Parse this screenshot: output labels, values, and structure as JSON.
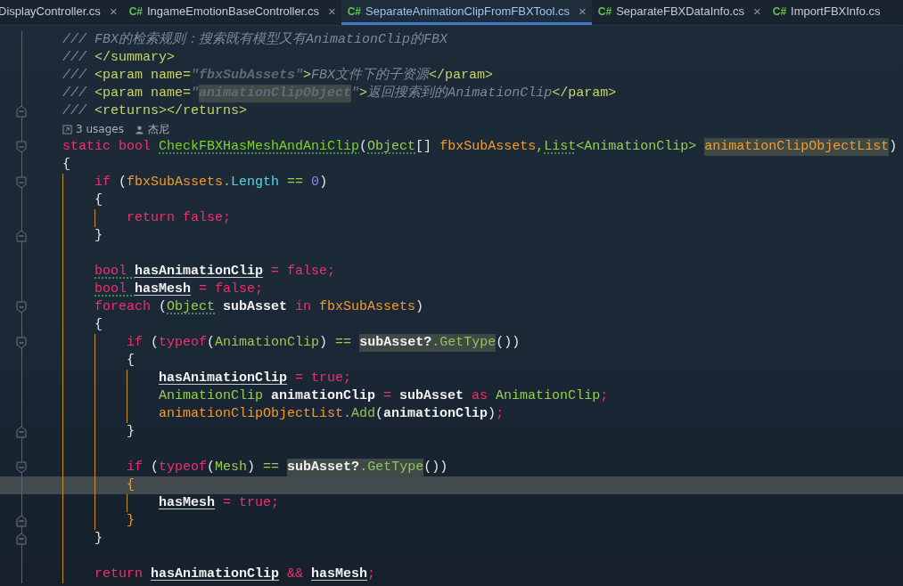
{
  "tabs": [
    {
      "label": "DisplayController.cs",
      "close": "×",
      "selected": false
    },
    {
      "icon_text": "C#",
      "label": "IngameEmotionBaseController.cs",
      "close": "×",
      "selected": false
    },
    {
      "icon_text": "C#",
      "label": "SeparateAnimationClipFromFBXTool.cs",
      "close": "×",
      "selected": true
    },
    {
      "icon_text": "C#",
      "label": "SeparateFBXDataInfo.cs",
      "close": "×",
      "selected": false
    },
    {
      "icon_text": "C#",
      "label": "ImportFBXInfo.cs",
      "selected": false
    }
  ],
  "lines": [
    {
      "kind": "code",
      "current": false,
      "tokens": [
        {
          "t": "/// FBX的检索规则：搜索既有模型又有AnimationClip的FBX",
          "kind": "comment"
        }
      ]
    },
    {
      "kind": "code",
      "current": false,
      "tokens": [
        {
          "t": "/// ",
          "kind": "comment"
        },
        {
          "t": "</summary>",
          "kind": "tag"
        }
      ]
    },
    {
      "kind": "code",
      "current": false,
      "tokens": [
        {
          "t": "/// ",
          "kind": "comment"
        },
        {
          "t": "<param name=",
          "kind": "tag"
        },
        {
          "t": "\"fbxSubAssets\"",
          "kind": "str"
        },
        {
          "t": ">",
          "kind": "tag"
        },
        {
          "t": "FBX文件下的子资源",
          "kind": "comment"
        },
        {
          "t": "</param>",
          "kind": "tag"
        }
      ]
    },
    {
      "kind": "code",
      "current": false,
      "tokens": [
        {
          "t": "/// ",
          "kind": "comment"
        },
        {
          "t": "<param name=",
          "kind": "tag"
        },
        {
          "t": "\"",
          "kind": "str"
        },
        {
          "t": "animationClipObject",
          "kind": "str",
          "mark": true
        },
        {
          "t": "\"",
          "kind": "str"
        },
        {
          "t": ">",
          "kind": "tag"
        },
        {
          "t": "返回搜索到的AnimationClip",
          "kind": "comment"
        },
        {
          "t": "</param>",
          "kind": "tag"
        }
      ]
    },
    {
      "kind": "code",
      "current": false,
      "fold_end": true,
      "tokens": [
        {
          "t": "/// ",
          "kind": "comment"
        },
        {
          "t": "<returns></returns>",
          "kind": "tag"
        }
      ]
    },
    {
      "kind": "lens",
      "usages": "3 usages",
      "author": "杰尼"
    },
    {
      "kind": "code",
      "current": false,
      "fold_start": true,
      "tokens": [
        {
          "t": "static bool ",
          "kind": "kw"
        },
        {
          "t": "CheckFBXHasMeshAndAniClip",
          "kind": "fn",
          "hint": true
        },
        {
          "t": "(",
          "kind": "punct"
        },
        {
          "t": "Object",
          "kind": "type",
          "hint": true
        },
        {
          "t": "[] ",
          "kind": "punct"
        },
        {
          "t": "fbxSubAssets",
          "kind": "param"
        },
        {
          "t": ",",
          "kind": "op"
        },
        {
          "t": "List",
          "kind": "type",
          "hint": true
        },
        {
          "t": "<",
          "kind": "op"
        },
        {
          "t": "AnimationClip",
          "kind": "type"
        },
        {
          "t": "> ",
          "kind": "op"
        },
        {
          "t": "animationClipObjectList",
          "kind": "param",
          "mark": true
        },
        {
          "t": ")",
          "kind": "punct"
        }
      ]
    },
    {
      "kind": "code",
      "current": false,
      "tokens": [
        {
          "t": "{",
          "kind": "punct"
        }
      ]
    },
    {
      "kind": "block",
      "children": [
        {
          "kind": "code",
          "current": false,
          "fold_start": true,
          "tokens": [
            {
              "t": "if ",
              "kind": "kw"
            },
            {
              "t": "(",
              "kind": "punct"
            },
            {
              "t": "fbxSubAssets",
              "kind": "param"
            },
            {
              "t": ".",
              "kind": "op"
            },
            {
              "t": "Length",
              "kind": "prop"
            },
            {
              "t": " == ",
              "kind": "op"
            },
            {
              "t": "0",
              "kind": "num"
            },
            {
              "t": ")",
              "kind": "punct"
            }
          ]
        },
        {
          "kind": "code",
          "current": false,
          "tokens": [
            {
              "t": "{",
              "kind": "punct"
            }
          ]
        },
        {
          "kind": "block",
          "children": [
            {
              "kind": "code",
              "current": false,
              "tokens": [
                {
                  "t": "return false;",
                  "kind": "kw"
                }
              ]
            }
          ]
        },
        {
          "kind": "code",
          "current": false,
          "fold_end": true,
          "tokens": [
            {
              "t": "}",
              "kind": "punct"
            }
          ]
        },
        {
          "kind": "blank"
        },
        {
          "kind": "code",
          "current": false,
          "tokens": [
            {
              "t": "bool ",
              "kind": "kw",
              "hint": true
            },
            {
              "t": "hasAnimationClip",
              "kind": "local"
            },
            {
              "t": " = false;",
              "kind": "kw"
            }
          ]
        },
        {
          "kind": "code",
          "current": false,
          "tokens": [
            {
              "t": "bool ",
              "kind": "kw",
              "hint": true
            },
            {
              "t": "hasMesh",
              "kind": "local"
            },
            {
              "t": " = false;",
              "kind": "kw"
            }
          ]
        },
        {
          "kind": "code",
          "current": false,
          "fold_start": true,
          "tokens": [
            {
              "t": "foreach ",
              "kind": "kw"
            },
            {
              "t": "(",
              "kind": "punct"
            },
            {
              "t": "Object",
              "kind": "type",
              "hint": true
            },
            {
              "t": " subAsset ",
              "kind": "var"
            },
            {
              "t": "in ",
              "kind": "kw"
            },
            {
              "t": "fbxSubAssets",
              "kind": "param"
            },
            {
              "t": ")",
              "kind": "punct"
            }
          ]
        },
        {
          "kind": "code",
          "current": false,
          "tokens": [
            {
              "t": "{",
              "kind": "punct"
            }
          ]
        },
        {
          "kind": "block",
          "children": [
            {
              "kind": "code",
              "current": false,
              "fold_start": true,
              "tokens": [
                {
                  "t": "if ",
                  "kind": "kw"
                },
                {
                  "t": "(",
                  "kind": "punct"
                },
                {
                  "t": "typeof",
                  "kind": "kw"
                },
                {
                  "t": "(",
                  "kind": "punct"
                },
                {
                  "t": "AnimationClip",
                  "kind": "type"
                },
                {
                  "t": ") ",
                  "kind": "punct"
                },
                {
                  "t": "== ",
                  "kind": "op"
                },
                {
                  "t": "subAsset?",
                  "kind": "var",
                  "mark": true
                },
                {
                  "t": ".GetType",
                  "kind": "method",
                  "mark": true
                },
                {
                  "t": "())",
                  "kind": "punct"
                }
              ]
            },
            {
              "kind": "code",
              "current": false,
              "tokens": [
                {
                  "t": "{",
                  "kind": "punct"
                }
              ]
            },
            {
              "kind": "block",
              "children": [
                {
                  "kind": "code",
                  "current": false,
                  "tokens": [
                    {
                      "t": "hasAnimationClip",
                      "kind": "local"
                    },
                    {
                      "t": " = true;",
                      "kind": "kw"
                    }
                  ]
                },
                {
                  "kind": "code",
                  "current": false,
                  "tokens": [
                    {
                      "t": "AnimationClip ",
                      "kind": "type"
                    },
                    {
                      "t": "animationClip ",
                      "kind": "var"
                    },
                    {
                      "t": "= ",
                      "kind": "kw"
                    },
                    {
                      "t": "subAsset ",
                      "kind": "var"
                    },
                    {
                      "t": "as ",
                      "kind": "kw"
                    },
                    {
                      "t": "AnimationClip",
                      "kind": "type"
                    },
                    {
                      "t": ";",
                      "kind": "kw"
                    }
                  ]
                },
                {
                  "kind": "code",
                  "current": false,
                  "tokens": [
                    {
                      "t": "animationClipObjectList",
                      "kind": "param"
                    },
                    {
                      "t": ".Add",
                      "kind": "method"
                    },
                    {
                      "t": "(",
                      "kind": "punct"
                    },
                    {
                      "t": "animationClip",
                      "kind": "var"
                    },
                    {
                      "t": ")",
                      "kind": "punct"
                    },
                    {
                      "t": ";",
                      "kind": "kw"
                    }
                  ]
                }
              ]
            },
            {
              "kind": "code",
              "current": false,
              "fold_end": true,
              "tokens": [
                {
                  "t": "}",
                  "kind": "punct"
                }
              ]
            },
            {
              "kind": "blank"
            },
            {
              "kind": "code",
              "current": false,
              "fold_start": true,
              "tokens": [
                {
                  "t": "if ",
                  "kind": "kw"
                },
                {
                  "t": "(",
                  "kind": "punct"
                },
                {
                  "t": "typeof",
                  "kind": "kw"
                },
                {
                  "t": "(",
                  "kind": "punct"
                },
                {
                  "t": "Mesh",
                  "kind": "type"
                },
                {
                  "t": ") ",
                  "kind": "punct"
                },
                {
                  "t": "== ",
                  "kind": "op"
                },
                {
                  "t": "subAsset?",
                  "kind": "var",
                  "mark": true
                },
                {
                  "t": ".GetType",
                  "kind": "method",
                  "mark": true
                },
                {
                  "t": "())",
                  "kind": "punct"
                }
              ]
            },
            {
              "kind": "code",
              "current": true,
              "tokens": [
                {
                  "t": "{",
                  "kind": "param"
                }
              ]
            },
            {
              "kind": "block",
              "children": [
                {
                  "kind": "code",
                  "current": false,
                  "tokens": [
                    {
                      "t": "hasMesh",
                      "kind": "local"
                    },
                    {
                      "t": " = true;",
                      "kind": "kw"
                    }
                  ]
                }
              ]
            },
            {
              "kind": "code",
              "current": false,
              "fold_end": true,
              "tokens": [
                {
                  "t": "}",
                  "kind": "param"
                }
              ]
            }
          ]
        },
        {
          "kind": "code",
          "current": false,
          "fold_end": true,
          "tokens": [
            {
              "t": "}",
              "kind": "punct"
            }
          ]
        },
        {
          "kind": "blank"
        },
        {
          "kind": "code",
          "current": false,
          "tokens": [
            {
              "t": "return ",
              "kind": "kw"
            },
            {
              "t": "hasAnimationClip",
              "kind": "local"
            },
            {
              "t": " && ",
              "kind": "kw"
            },
            {
              "t": "hasMesh",
              "kind": "local"
            },
            {
              "t": ";",
              "kind": "kw"
            }
          ]
        }
      ]
    }
  ]
}
